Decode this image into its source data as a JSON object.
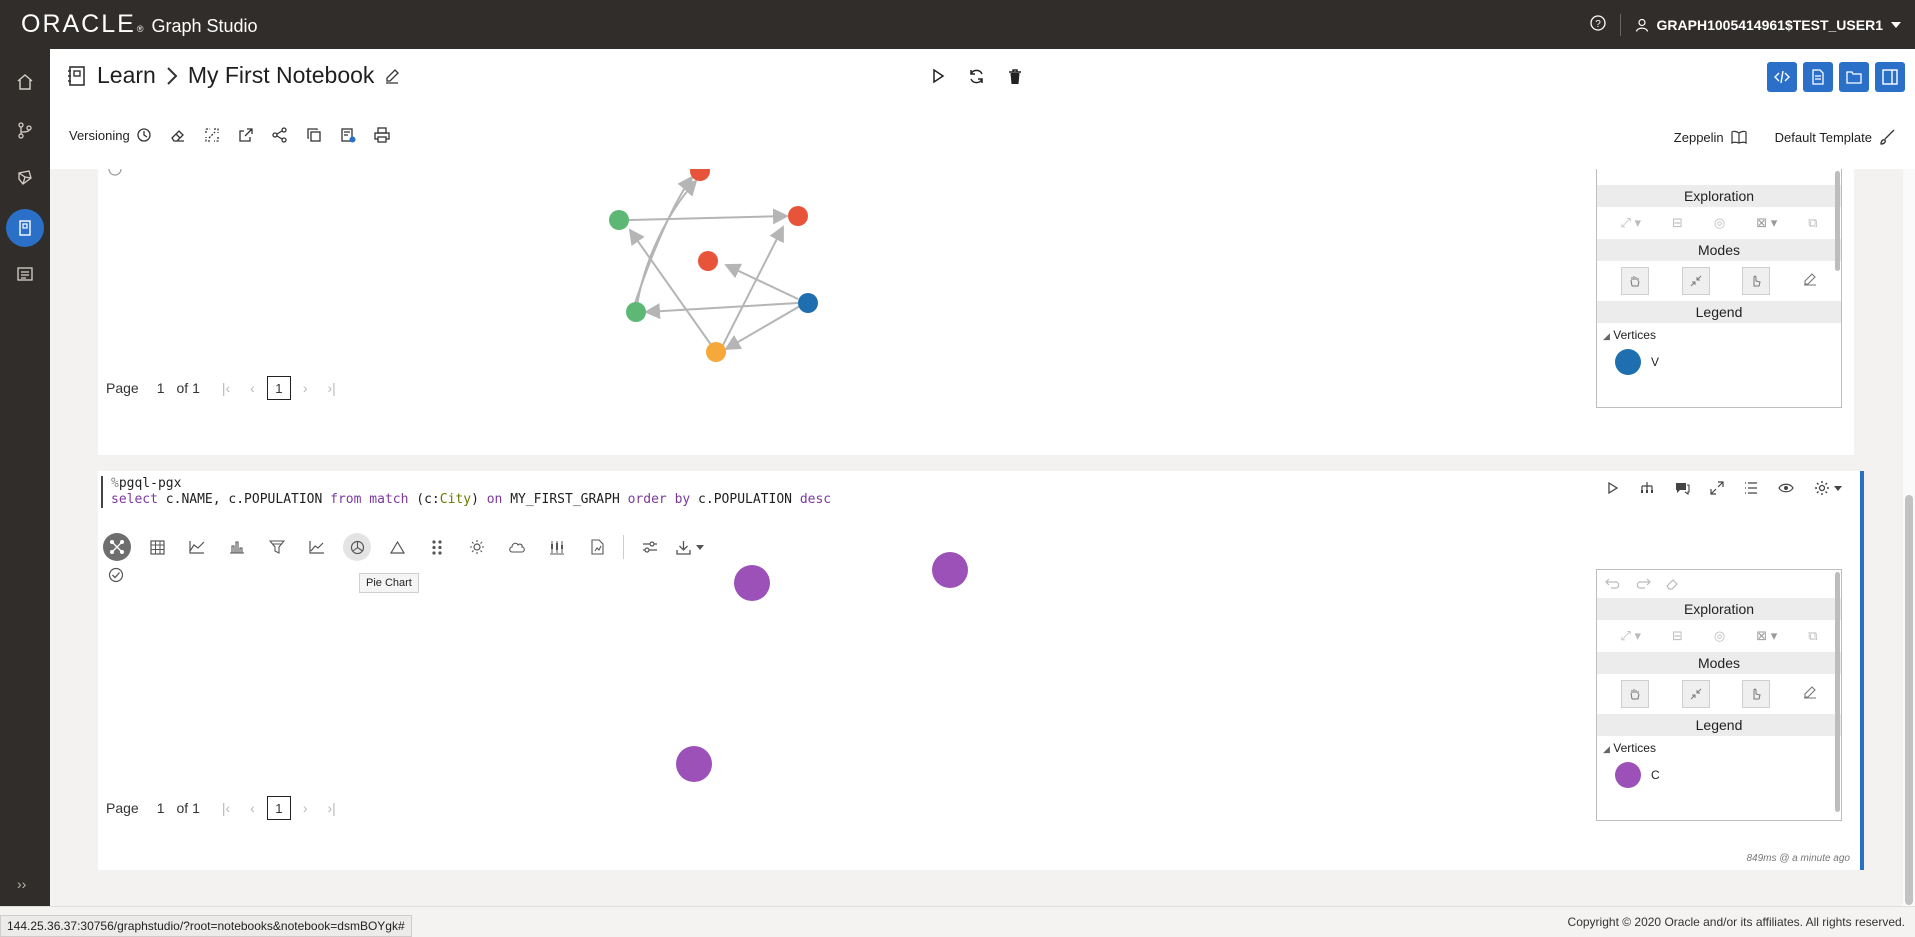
{
  "header": {
    "brand": "ORACLE",
    "product": "Graph Studio",
    "user": "GRAPH1005414961$TEST_USER1"
  },
  "notebook": {
    "breadcrumb_root": "Learn",
    "title": "My First Notebook"
  },
  "toolbar": {
    "versioning_label": "Versioning",
    "interpreter_label": "Zeppelin",
    "template_label": "Default Template"
  },
  "paragraph1": {
    "pager": {
      "label": "Page",
      "current": "1",
      "of": "of 1",
      "box": "1"
    },
    "panel": {
      "exploration": "Exploration",
      "modes": "Modes",
      "legend": "Legend",
      "vertices": "Vertices",
      "legend_item": "V"
    }
  },
  "paragraph2": {
    "code_line1_prefix": "%",
    "code_line1": "pgql-pgx",
    "code_select": "select",
    "code_cols": " c.NAME, c.POPULATION ",
    "code_from": "from",
    "code_match": "match",
    "code_pre_label": " (c:",
    "code_label": "City",
    "code_post_label": ") ",
    "code_on": "on",
    "code_graph": " MY_FIRST_GRAPH ",
    "code_order": "order by",
    "code_tail": " c.POPULATION ",
    "code_desc": "desc",
    "tooltip": "Pie Chart",
    "pager": {
      "label": "Page",
      "current": "1",
      "of": "of 1",
      "box": "1"
    },
    "panel": {
      "exploration": "Exploration",
      "modes": "Modes",
      "legend": "Legend",
      "vertices": "Vertices",
      "legend_item": "C"
    },
    "timing": "849ms @ a minute ago"
  },
  "statusbar": {
    "url": "144.25.36.37:30756/graphstudio/?root=notebooks&notebook=dsmBOYgk#",
    "copyright": "Copyright © 2020 Oracle and/or its affiliates. All rights reserved."
  },
  "colors": {
    "accent": "#2a70c8",
    "vertex_blue": "#1f6fb0",
    "vertex_red": "#e8543a",
    "vertex_green": "#5cb874",
    "vertex_orange": "#f7a83b",
    "vertex_purple": "#9b51b8"
  }
}
